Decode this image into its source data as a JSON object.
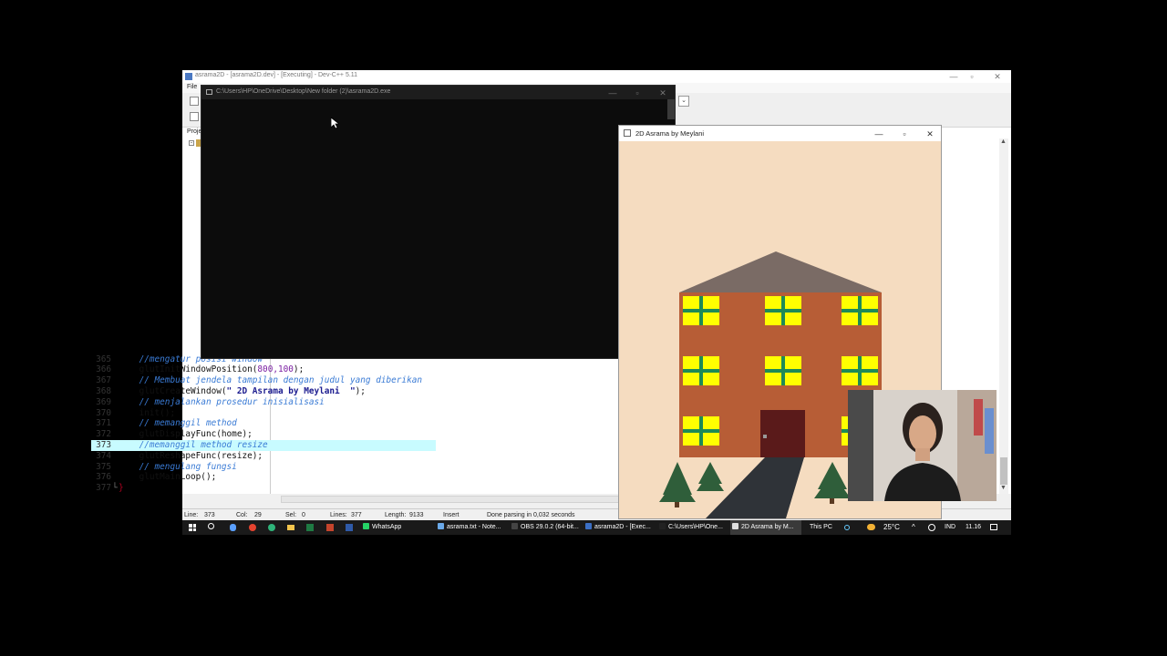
{
  "devcpp": {
    "title": "asrama2D - [asrama2D.dev] - [Executing] - Dev-C++ 5.11",
    "menu_file": "File",
    "project_tab": "Proje",
    "code_lines": [
      {
        "num": "365",
        "text": "//mengatur posisi window",
        "comment": true,
        "hl": false
      },
      {
        "num": "366",
        "text": "glutInitWindowPosition(",
        "num_arg": "800,100",
        "tail": ");",
        "comment": false,
        "hl": false
      },
      {
        "num": "367",
        "text": "// Membuat jendela tampilan dengan judul yang diberikan",
        "comment": true,
        "hl": false
      },
      {
        "num": "368",
        "text": "glutCreateWindow(",
        "str_arg": "\" 2D Asrama by Meylani  \"",
        "tail": ");",
        "comment": false,
        "hl": false
      },
      {
        "num": "369",
        "text": "// menjalankan prosedur inisialisasi",
        "comment": true,
        "hl": false
      },
      {
        "num": "370",
        "text": "init();",
        "comment": false,
        "hl": false
      },
      {
        "num": "371",
        "text": "// memanggil method",
        "comment": true,
        "hl": false
      },
      {
        "num": "372",
        "text": "glutDisplayFunc(home);",
        "comment": false,
        "hl": false
      },
      {
        "num": "373",
        "text": "//memanggil method resize",
        "comment": true,
        "hl": true
      },
      {
        "num": "374",
        "text": "glutReshapeFunc(resize);",
        "comment": false,
        "hl": false
      },
      {
        "num": "375",
        "text": "// mengulang fungsi",
        "comment": true,
        "hl": false
      },
      {
        "num": "376",
        "text": "glutMainLoop();",
        "comment": false,
        "hl": false
      },
      {
        "num": "377",
        "text": "}",
        "comment": false,
        "hl": false
      }
    ],
    "status": {
      "line": "Line:",
      "line_val": "373",
      "col": "Col:",
      "col_val": "29",
      "sel": "Sel:",
      "sel_val": "0",
      "lines": "Lines:",
      "lines_val": "377",
      "length": "Length:",
      "length_val": "9133",
      "mode": "Insert",
      "message": "Done parsing in 0,032 seconds"
    }
  },
  "console": {
    "title": "C:\\Users\\HP\\OneDrive\\Desktop\\New folder (2)\\asrama2D.exe"
  },
  "glut": {
    "title": "2D Asrama by Meylani"
  },
  "taskbar": {
    "items": [
      {
        "label": "WhatsApp",
        "color": "#25d366"
      },
      {
        "label": "asrama.txt - Note...",
        "color": "#6aa9e9"
      },
      {
        "label": "OBS 29.0.2 (64-bit...",
        "color": "#444444"
      },
      {
        "label": "asrama2D - [Exec...",
        "color": "#3b6fc4"
      },
      {
        "label": "C:\\Users\\HP\\One...",
        "color": "#222222"
      },
      {
        "label": "2D Asrama by M...",
        "color": "#e0e0e0"
      }
    ],
    "this_pc": "This PC",
    "weather": "25°C",
    "lang": "IND",
    "time": "11.16"
  },
  "colors": {
    "sky": "#f5dcc0",
    "roof": "#7a6b65",
    "wall": "#b75d36",
    "window_frame": "#ffff00",
    "window_bar": "#1d8a57",
    "door": "#5a1a1a",
    "path": "#2f3338",
    "tree": "#2f5e3a"
  }
}
